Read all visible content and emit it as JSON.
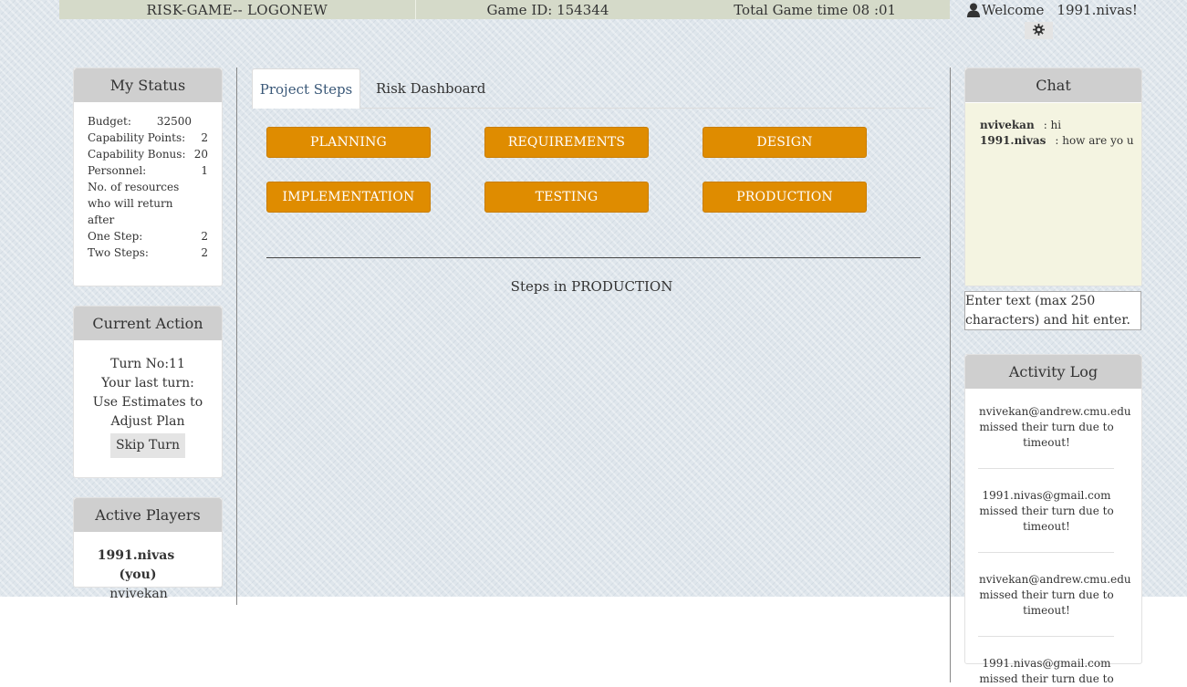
{
  "header": {
    "title": "RISK-GAME-- LOGONEW",
    "game_id": "Game ID: 154344",
    "total_time": "Total Game time 08 :01",
    "welcome_prefix": "Welcome",
    "welcome_user": "1991.nivas!",
    "gear_icon": "gear-icon",
    "user_icon": "user-icon"
  },
  "my_status": {
    "title": "My Status",
    "rows": [
      {
        "k": "Budget:",
        "v": "32500"
      },
      {
        "k": "Capability Points:",
        "v": "2"
      },
      {
        "k": "Capability Bonus:",
        "v": "20"
      },
      {
        "k": "Personnel:",
        "v": "1"
      }
    ],
    "resources_text_1": "No. of resources",
    "resources_text_2": "who will return",
    "resources_text_3": "after",
    "rows2": [
      {
        "k": "One Step:",
        "v": "2"
      },
      {
        "k": "Two Steps:",
        "v": "2"
      }
    ]
  },
  "current_action": {
    "title": "Current Action",
    "turn": "Turn No:11",
    "last_turn_label": "Your last turn:",
    "last_turn_value_1": "Use Estimates to",
    "last_turn_value_2": "Adjust Plan",
    "skip_turn": "Skip Turn"
  },
  "active_players": {
    "title": "Active Players",
    "me": "1991.nivas",
    "me_suffix": "(you)",
    "other": "nvivekan"
  },
  "tabs": [
    {
      "label": "Project Steps",
      "active": true
    },
    {
      "label": "Risk Dashboard",
      "active": false
    }
  ],
  "steps": [
    "PLANNING",
    "REQUIREMENTS",
    "DESIGN",
    "IMPLEMENTATION",
    "TESTING",
    "PRODUCTION"
  ],
  "steps_in": "Steps in PRODUCTION",
  "chat": {
    "title": "Chat",
    "messages": [
      {
        "user": "nvivekan",
        "text": ": hi"
      },
      {
        "user": "1991.nivas",
        "text": ": how are yo u"
      }
    ],
    "input_placeholder": "Enter text (max 250 characters) and hit enter."
  },
  "activity_log": {
    "title": "Activity Log",
    "entries": [
      {
        "email": "nvivekan@andrew.cmu.edu",
        "msg1": "missed their turn due to",
        "msg2": "timeout!"
      },
      {
        "email": "1991.nivas@gmail.com",
        "msg1": "missed their turn due to",
        "msg2": "timeout!"
      },
      {
        "email": "nvivekan@andrew.cmu.edu",
        "msg1": "missed their turn due to",
        "msg2": "timeout!"
      },
      {
        "email": "1991.nivas@gmail.com",
        "msg1": "missed their turn due to",
        "msg2": ""
      }
    ]
  },
  "colors": {
    "accent": "#df8c00",
    "topbar": "#d5dac9",
    "panel_header": "#cfcfcf",
    "chat_bg": "#f4f4e1"
  }
}
